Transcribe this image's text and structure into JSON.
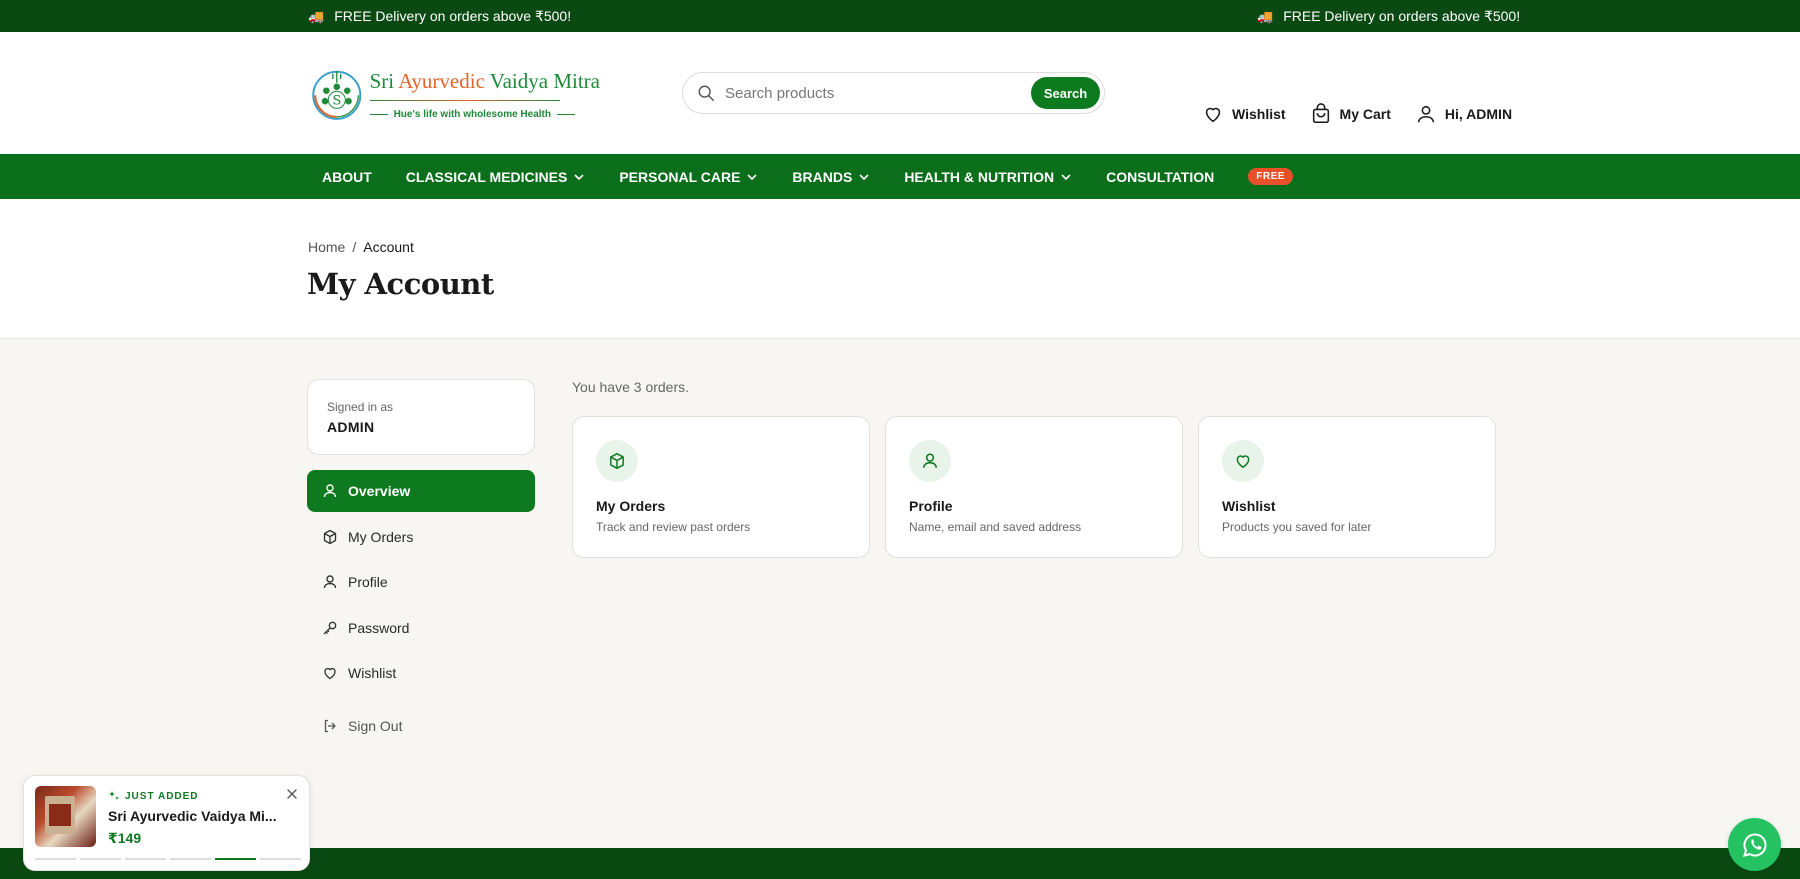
{
  "topbar": {
    "messages": [
      "FREE Delivery on orders above ₹500!",
      "FREE Delivery on orders above ₹500!"
    ]
  },
  "logo": {
    "title_part1": "Sri ",
    "title_part2": "Ayurvedic",
    "title_part3": " Vaidya Mitra",
    "tagline": "Hue's life with wholesome Health"
  },
  "search": {
    "placeholder": "Search products",
    "button_label": "Search"
  },
  "header_actions": {
    "wishlist": "Wishlist",
    "cart": "My Cart",
    "account": "Hi, ADMIN"
  },
  "nav": {
    "items": [
      {
        "label": "ABOUT",
        "dropdown": false
      },
      {
        "label": "CLASSICAL MEDICINES",
        "dropdown": true
      },
      {
        "label": "PERSONAL CARE",
        "dropdown": true
      },
      {
        "label": "BRANDS",
        "dropdown": true
      },
      {
        "label": "HEALTH & NUTRITION",
        "dropdown": true
      },
      {
        "label": "CONSULTATION",
        "dropdown": false
      }
    ],
    "badge": "FREE"
  },
  "breadcrumb": {
    "home": "Home",
    "separator": "/",
    "current": "Account"
  },
  "page_title": "My Account",
  "sidebar": {
    "signed_in_label": "Signed in as",
    "signed_in_name": "ADMIN",
    "menu": [
      {
        "label": "Overview",
        "icon": "user-icon",
        "active": true
      },
      {
        "label": "My Orders",
        "icon": "box-icon",
        "active": false
      },
      {
        "label": "Profile",
        "icon": "user-icon",
        "active": false
      },
      {
        "label": "Password",
        "icon": "key-icon",
        "active": false
      },
      {
        "label": "Wishlist",
        "icon": "heart-icon",
        "active": false
      }
    ],
    "sign_out": "Sign Out"
  },
  "main": {
    "orders_summary": "You have 3 orders.",
    "cards": [
      {
        "title": "My Orders",
        "description": "Track and review past orders",
        "icon": "box-icon"
      },
      {
        "title": "Profile",
        "description": "Name, email and saved address",
        "icon": "user-icon"
      },
      {
        "title": "Wishlist",
        "description": "Products you saved for later",
        "icon": "heart-icon"
      }
    ]
  },
  "toast": {
    "label": "JUST ADDED",
    "product_name": "Sri Ayurvedic Vaidya Mi...",
    "price": "₹149",
    "slide_total": 6,
    "slide_active": 5
  },
  "colors": {
    "brand_green": "#0e7a1f",
    "nav_green": "#0a6e1a",
    "topbar_green": "#0a4a12",
    "badge_orange": "#e8502a",
    "whatsapp_green": "#25c262"
  }
}
